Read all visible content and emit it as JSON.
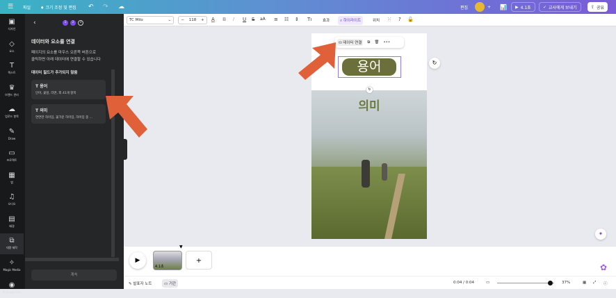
{
  "topbar": {
    "file": "파일",
    "resize": "크기 조정 및 편집",
    "edit": "편집",
    "duration": "4.1초",
    "send": "교사에게 보내기",
    "share": "공유"
  },
  "toolbar": {
    "font": "TC Milo",
    "size": "118",
    "effects": "효과",
    "highlight": "하이라이트",
    "position": "위치"
  },
  "rail": [
    {
      "label": "디자인",
      "icon": "layout-icon"
    },
    {
      "label": "요소",
      "icon": "shapes-icon"
    },
    {
      "label": "텍스트",
      "icon": "text-icon"
    },
    {
      "label": "브랜드 관리",
      "icon": "brand-icon"
    },
    {
      "label": "업로드 항목",
      "icon": "upload-icon"
    },
    {
      "label": "Draw",
      "icon": "draw-icon"
    },
    {
      "label": "프로젝트",
      "icon": "folder-icon"
    },
    {
      "label": "앱",
      "icon": "apps-icon"
    },
    {
      "label": "오디오",
      "icon": "music-icon"
    },
    {
      "label": "배경",
      "icon": "background-icon"
    },
    {
      "label": "대량 제작",
      "icon": "bulk-create-icon"
    },
    {
      "label": "Magic Media",
      "icon": "magic-media-icon"
    },
    {
      "label": "AI Image Gen",
      "icon": "ai-image-icon"
    }
  ],
  "panel": {
    "steps": [
      "1",
      "2",
      "3"
    ],
    "title": "데이터와 요소를 연결",
    "desc1": "페이지의 요소를 마우스 오른쪽 버튼으로",
    "desc2": "클릭하면 아래 데이터에 연결할 수 있습니다",
    "subtitle": "데이터 필드가 추가되지 않음",
    "fields": [
      {
        "name": "용어",
        "values": "단어, 꽃잎, 라면, 외 41개 항목"
      },
      {
        "name": "의미",
        "values": "연연한 하이임, 꽃가운 하이임, 하이임 중 ..."
      }
    ],
    "continue": "계속"
  },
  "canvas": {
    "connect_data": "데이터 연결",
    "term": "용어",
    "meaning": "의미"
  },
  "timeline": {
    "thumb_duration": "4.1초"
  },
  "footer": {
    "notes": "발표자 노트",
    "duration": "기간",
    "time": "0:04 / 0:04",
    "zoom": "37%"
  },
  "colors": {
    "accent": "#8b3dff",
    "arrow": "#e0603a",
    "pill": "#6b6f3c"
  },
  "zoom_level": 0.37
}
